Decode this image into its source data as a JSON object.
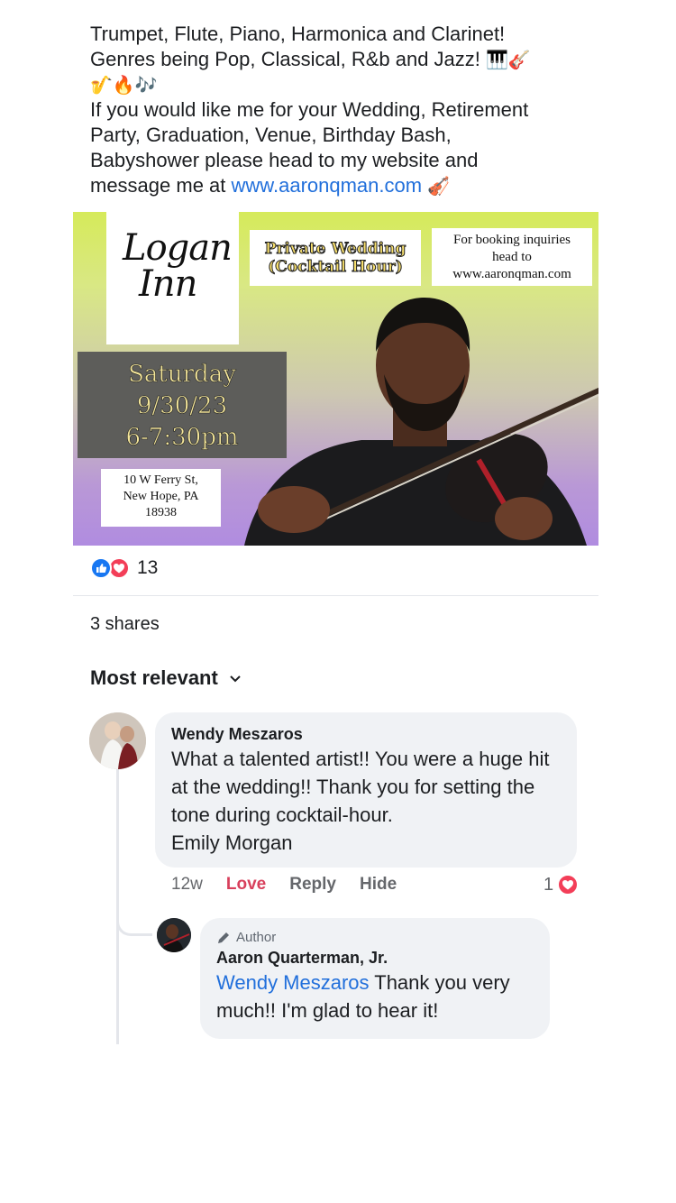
{
  "post": {
    "line1": "Trumpet, Flute, Piano, Harmonica and Clarinet!",
    "line2": "Genres being Pop, Classical, R&b and Jazz!",
    "line2_emoji": "🎹🎸",
    "line3_emoji": "🎷🔥🎶",
    "line4": "If you would like me for your Wedding, Retirement",
    "line5": "Party, Graduation, Venue, Birthday Bash,",
    "line6": "Babyshower please head to my website and",
    "line7_prefix": "message me at",
    "website_link": "www.aaronqman.com",
    "line7_emoji": "🎻"
  },
  "flyer": {
    "logo_line1": "Logan",
    "logo_line2": "Inn",
    "event_line1": "Private Wedding",
    "event_line2": "(Cocktail Hour)",
    "booking_line1": "For booking inquiries",
    "booking_line2": "head to",
    "booking_line3": "www.aaronqman.com",
    "date_day": "Saturday",
    "date": "9/30/23",
    "time": "6-7:30pm",
    "addr_line1": "10 W Ferry St,",
    "addr_line2": "New Hope, PA",
    "addr_line3": "18938"
  },
  "reactions": {
    "count": "13",
    "icons": [
      "like-icon",
      "love-icon"
    ]
  },
  "shares": "3 shares",
  "sort_label": "Most relevant",
  "comments": [
    {
      "author": "Wendy Meszaros",
      "text": "What a talented artist!!  You were a huge hit at the wedding!!   Thank you for setting the tone during cocktail-hour.",
      "mention": "Emily Morgan",
      "time": "12w",
      "love_label": "Love",
      "reply_label": "Reply",
      "hide_label": "Hide",
      "reaction_count": "1"
    }
  ],
  "reply": {
    "badge": "Author",
    "author": "Aaron Quarterman, Jr.",
    "mention": "Wendy Meszaros",
    "text": " Thank you very much!! I'm glad to hear it!"
  },
  "colors": {
    "link": "#216fdb",
    "like": "#1877f2",
    "love": "#f33e58",
    "bubble": "#f0f2f5"
  }
}
